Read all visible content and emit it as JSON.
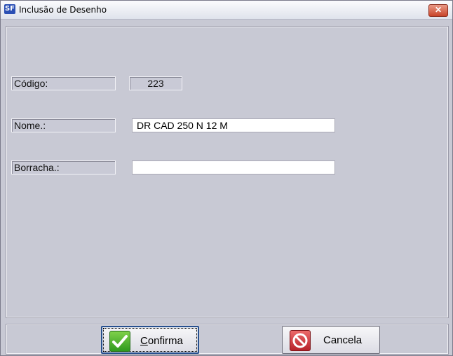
{
  "window": {
    "title": "Inclusão  de Desenho",
    "icon_text": "SF",
    "close_glyph": "✕"
  },
  "form": {
    "codigo_label": "Código:",
    "codigo_value": "223",
    "nome_label": "Nome.:",
    "nome_value": "DR CAD 250 N 12 M",
    "borracha_label": "Borracha.:",
    "borracha_value": ""
  },
  "buttons": {
    "confirm_label_first": "C",
    "confirm_label_rest": "onfirma",
    "cancel_label": "Cancela"
  },
  "colors": {
    "background": "#c8c9d4",
    "confirm_icon": "#2f9a1e",
    "cancel_icon": "#b8222a"
  },
  "icons": {
    "app": "sf-app-icon",
    "close": "close-icon",
    "confirm": "checkmark-icon",
    "cancel": "no-entry-icon"
  }
}
